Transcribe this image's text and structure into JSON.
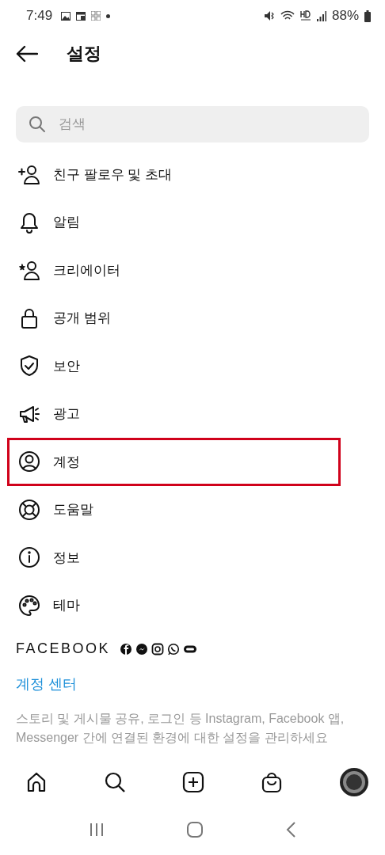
{
  "status_bar": {
    "time": "7:49",
    "battery": "88%"
  },
  "header": {
    "title": "설정"
  },
  "search": {
    "placeholder": "검색"
  },
  "menu_items": [
    {
      "label": "친구 팔로우 및 초대",
      "highlighted": false
    },
    {
      "label": "알림",
      "highlighted": false
    },
    {
      "label": "크리에이터",
      "highlighted": false
    },
    {
      "label": "공개 범위",
      "highlighted": false
    },
    {
      "label": "보안",
      "highlighted": false
    },
    {
      "label": "광고",
      "highlighted": false
    },
    {
      "label": "계정",
      "highlighted": true
    },
    {
      "label": "도움말",
      "highlighted": false
    },
    {
      "label": "정보",
      "highlighted": false
    },
    {
      "label": "테마",
      "highlighted": false
    }
  ],
  "facebook_section": {
    "heading": "FACEBOOK",
    "link": "계정 센터",
    "description": "스토리 및 게시물 공유, 로그인 등 Instagram, Facebook 앱, Messenger 간에 연결된 환경에 대한 설정을 관리하세요"
  }
}
